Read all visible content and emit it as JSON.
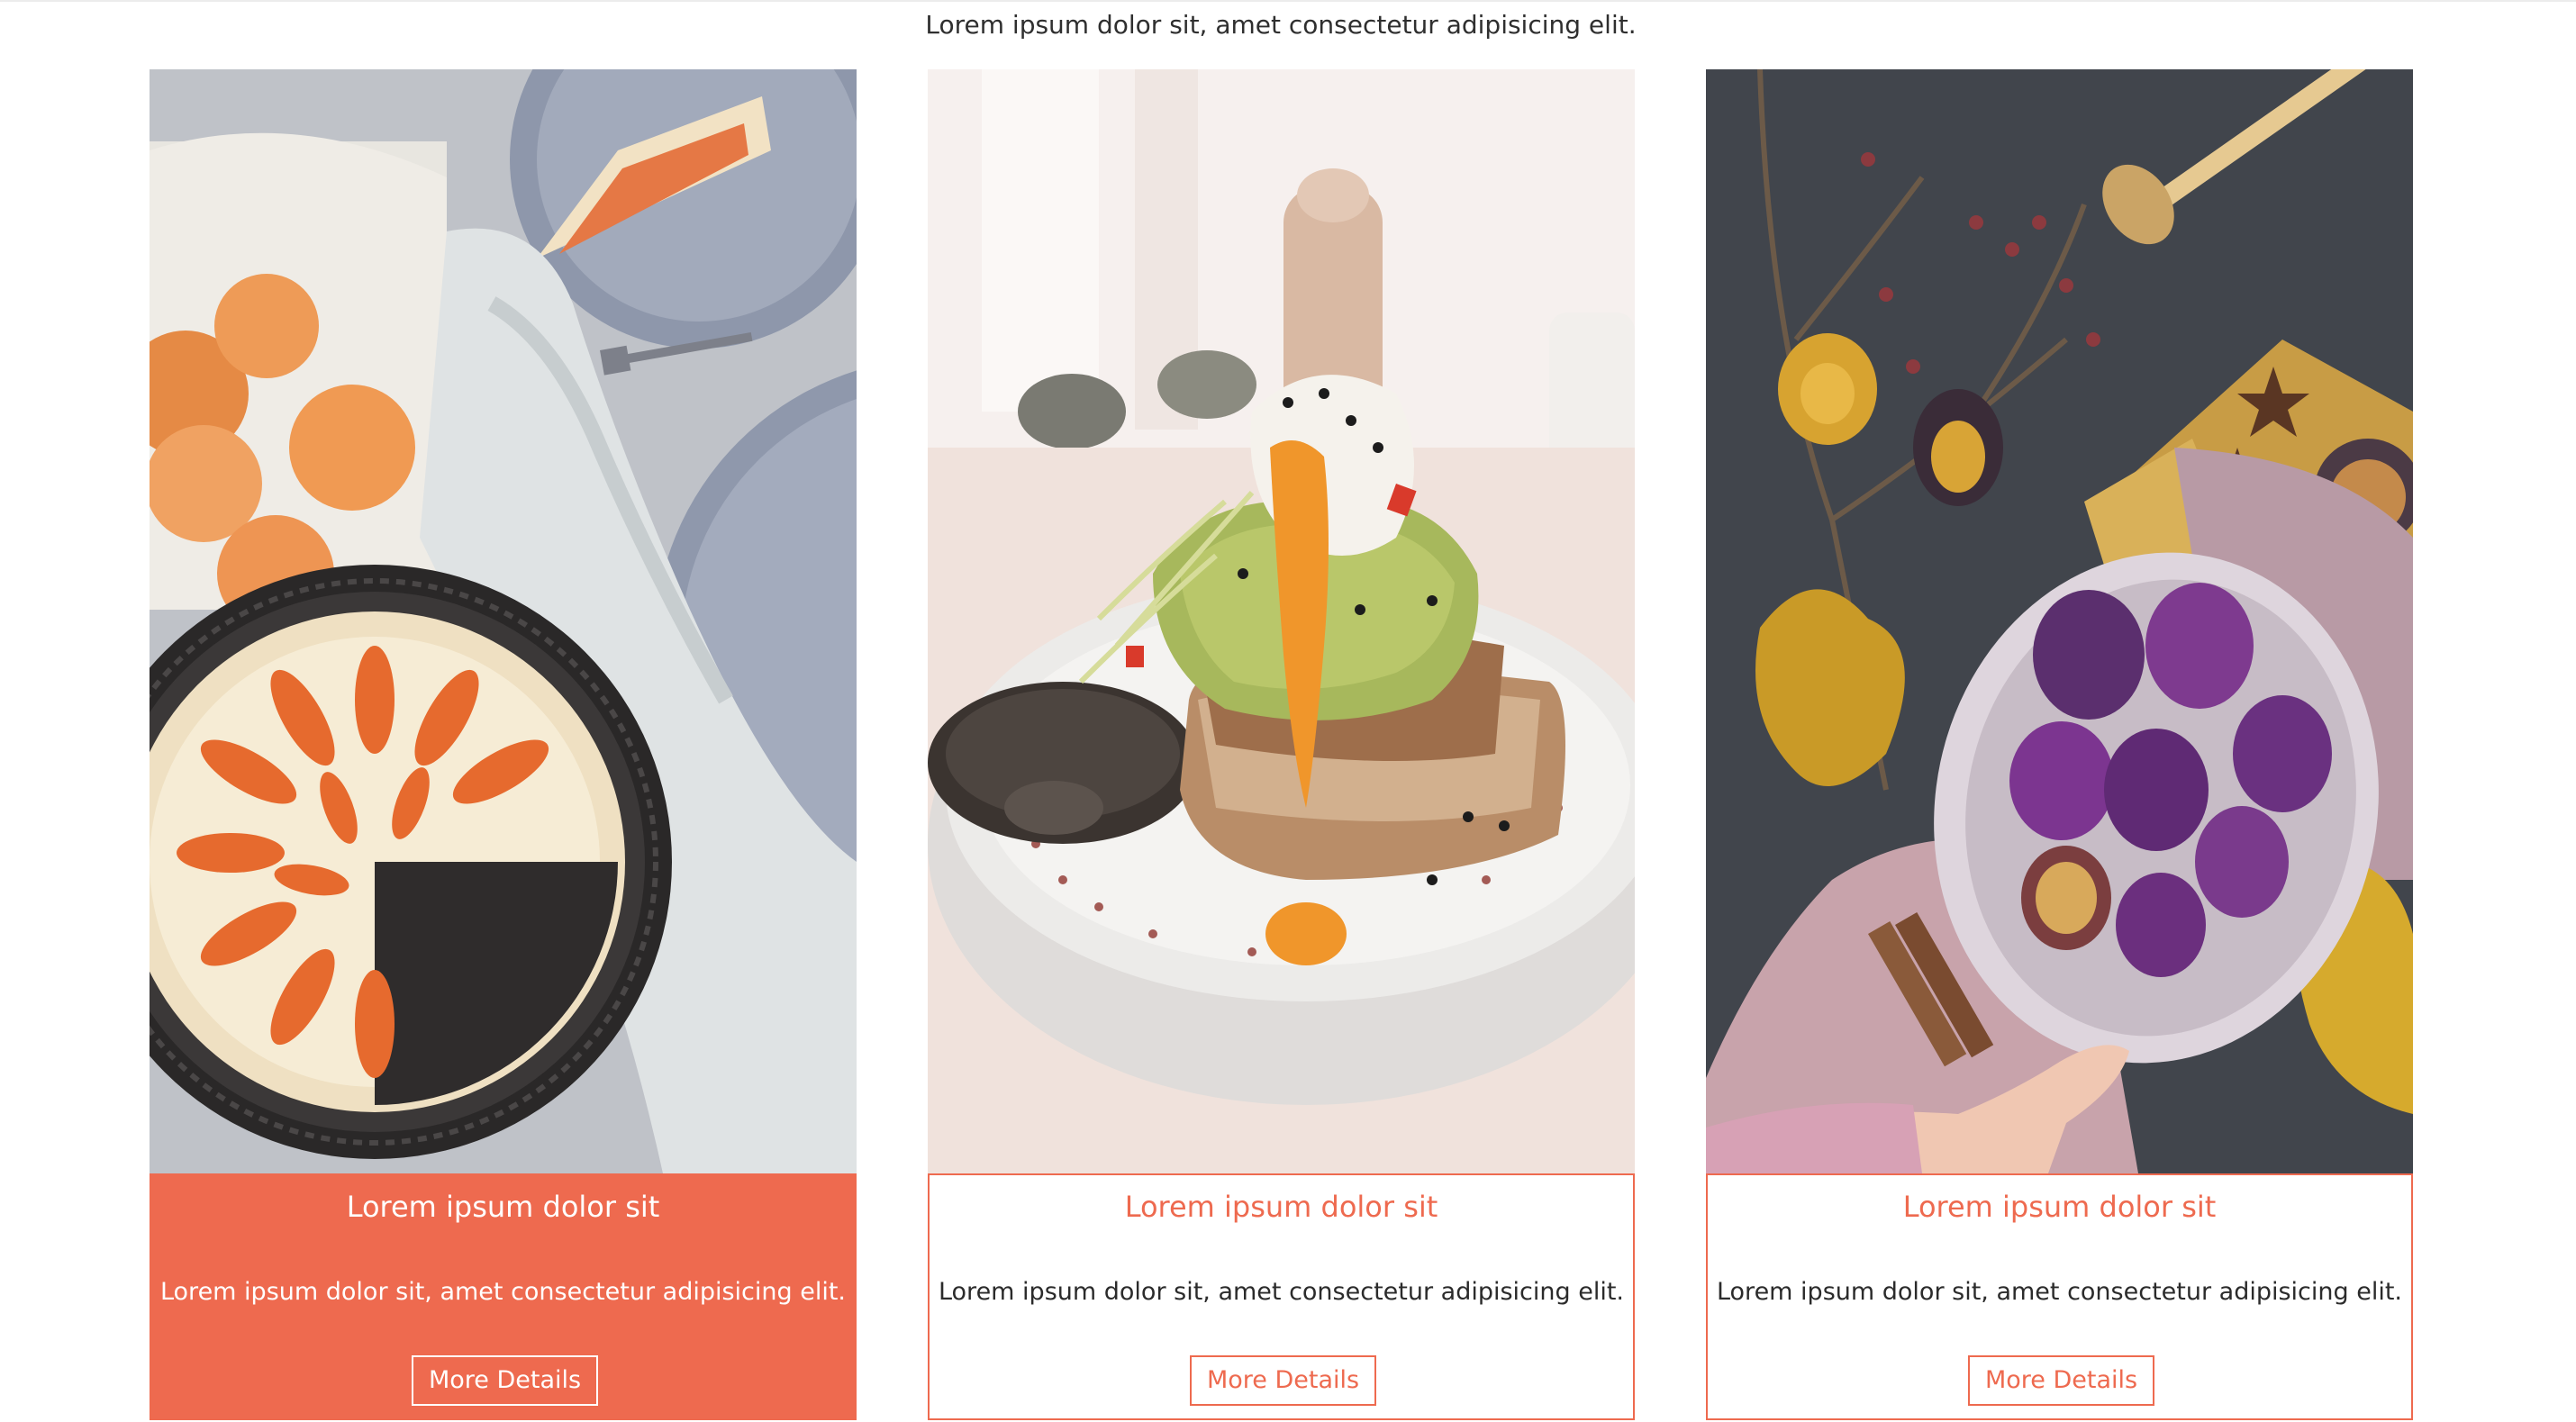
{
  "intro": {
    "text": "Lorem ipsum dolor sit, amet consectetur adipisicing elit."
  },
  "cards": [
    {
      "image": "apricot-tart-photo",
      "title": "Lorem ipsum dolor sit",
      "description": "Lorem ipsum dolor sit, amet consectetur adipisicing elit.",
      "button_label": "More Details",
      "state": "active"
    },
    {
      "image": "egg-avocado-toast-photo",
      "title": "Lorem ipsum dolor sit",
      "description": "Lorem ipsum dolor sit, amet consectetur adipisicing elit.",
      "button_label": "More Details",
      "state": "default"
    },
    {
      "image": "figs-bowl-photo",
      "title": "Lorem ipsum dolor sit",
      "description": "Lorem ipsum dolor sit, amet consectetur adipisicing elit.",
      "button_label": "More Details",
      "state": "default"
    }
  ],
  "colors": {
    "accent": "#ee6a4f",
    "text": "#2b2b2b",
    "background": "#ffffff"
  }
}
